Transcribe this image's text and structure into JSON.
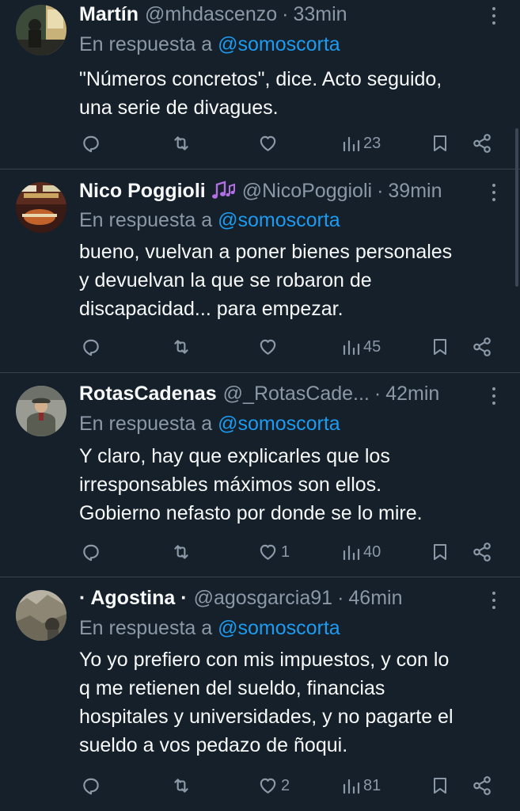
{
  "reply_prefix": "En respuesta a",
  "colors": {
    "background": "#15202b",
    "text": "#f7f9f9",
    "secondary": "#8b98a5",
    "accent": "#1d9bf0",
    "divider": "#38444d"
  },
  "tweets": [
    {
      "name": "Martín",
      "handle": "@mhdascenzo",
      "separator": "·",
      "time": "33min",
      "reply_mention": "@somoscorta",
      "text_lines": [
        "\"Números concretos\", dice. Acto seguido,",
        "una serie de divagues."
      ],
      "likes": "",
      "views": "23"
    },
    {
      "name": "Nico Poggioli",
      "name_emoji": "music-notes",
      "handle": "@NicoPoggioli",
      "separator": "·",
      "time": "39min",
      "reply_mention": "@somoscorta",
      "text_lines": [
        "bueno, vuelvan a poner bienes personales",
        "y devuelvan la que se robaron de",
        "discapacidad... para empezar."
      ],
      "likes": "",
      "views": "45"
    },
    {
      "name": "RotasCadenas",
      "handle": "@_RotasCade...",
      "separator": "·",
      "time": "42min",
      "reply_mention": "@somoscorta",
      "text_lines": [
        "Y claro, hay que explicarles que los",
        "irresponsables máximos son ellos.",
        "Gobierno nefasto por donde se lo mire."
      ],
      "likes": "1",
      "views": "40"
    },
    {
      "name": "· Agostina ·",
      "handle": "@agosgarcia91",
      "separator": "·",
      "time": "46min",
      "reply_mention": "@somoscorta",
      "text_lines": [
        "Yo yo prefiero con mis impuestos, y con lo",
        "q me retienen del sueldo, financias",
        "hospitales y universidades, y no pagarte el",
        "sueldo a vos pedazo de ñoqui."
      ],
      "likes": "2",
      "views": "81"
    }
  ]
}
